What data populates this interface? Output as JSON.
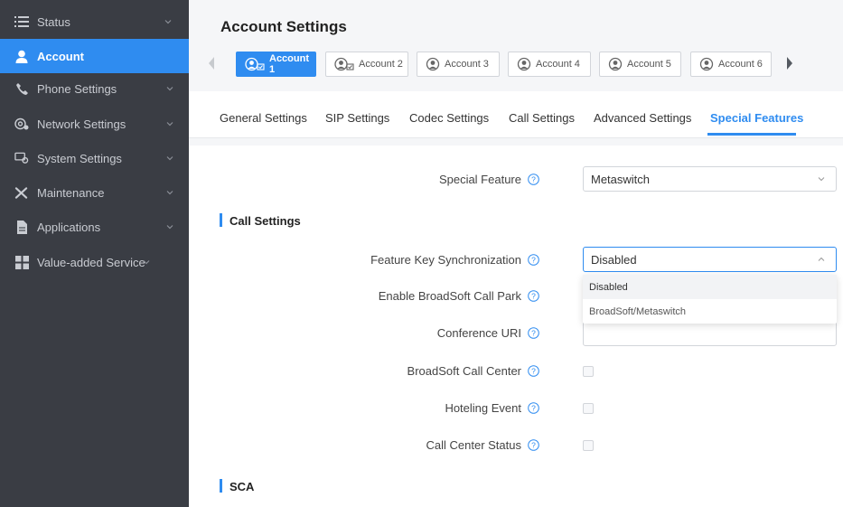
{
  "sidebar": {
    "items": [
      {
        "label": "Status",
        "icon": "list-icon",
        "active": false
      },
      {
        "label": "Account",
        "icon": "user-icon",
        "active": true
      },
      {
        "label": "Phone Settings",
        "icon": "phone-icon",
        "active": false
      },
      {
        "label": "Network Settings",
        "icon": "network-icon",
        "active": false
      },
      {
        "label": "System Settings",
        "icon": "system-icon",
        "active": false
      },
      {
        "label": "Maintenance",
        "icon": "tools-icon",
        "active": false
      },
      {
        "label": "Applications",
        "icon": "document-icon",
        "active": false
      },
      {
        "label": "Value-added Service",
        "icon": "grid-icon",
        "active": false
      }
    ]
  },
  "header": {
    "title": "Account Settings",
    "accounts": [
      {
        "label": "Account 1",
        "active": true
      },
      {
        "label": "Account 2",
        "active": false
      },
      {
        "label": "Account 3",
        "active": false
      },
      {
        "label": "Account 4",
        "active": false
      },
      {
        "label": "Account 5",
        "active": false
      },
      {
        "label": "Account 6",
        "active": false
      }
    ]
  },
  "tabs": [
    {
      "label": "General Settings",
      "active": false
    },
    {
      "label": "SIP Settings",
      "active": false
    },
    {
      "label": "Codec Settings",
      "active": false
    },
    {
      "label": "Call Settings",
      "active": false
    },
    {
      "label": "Advanced Settings",
      "active": false
    },
    {
      "label": "Special Features",
      "active": true
    }
  ],
  "form": {
    "special_feature": {
      "label": "Special Feature",
      "value": "Metaswitch"
    },
    "section_call_settings": "Call Settings",
    "feature_key_sync": {
      "label": "Feature Key Synchronization",
      "value": "Disabled"
    },
    "dropdown_options": [
      "Disabled",
      "BroadSoft/Metaswitch"
    ],
    "broadsoft_call_park": {
      "label": "Enable BroadSoft Call Park"
    },
    "conference_uri": {
      "label": "Conference URI",
      "value": ""
    },
    "broadsoft_call_center": {
      "label": "BroadSoft Call Center",
      "checked": false
    },
    "hoteling_event": {
      "label": "Hoteling Event",
      "checked": false
    },
    "call_center_status": {
      "label": "Call Center Status",
      "checked": false
    },
    "section_sca": "SCA"
  },
  "colors": {
    "sidebar_bg": "#3a3d44",
    "accent": "#2f8cf0",
    "page_bg": "#f5f6f8"
  }
}
